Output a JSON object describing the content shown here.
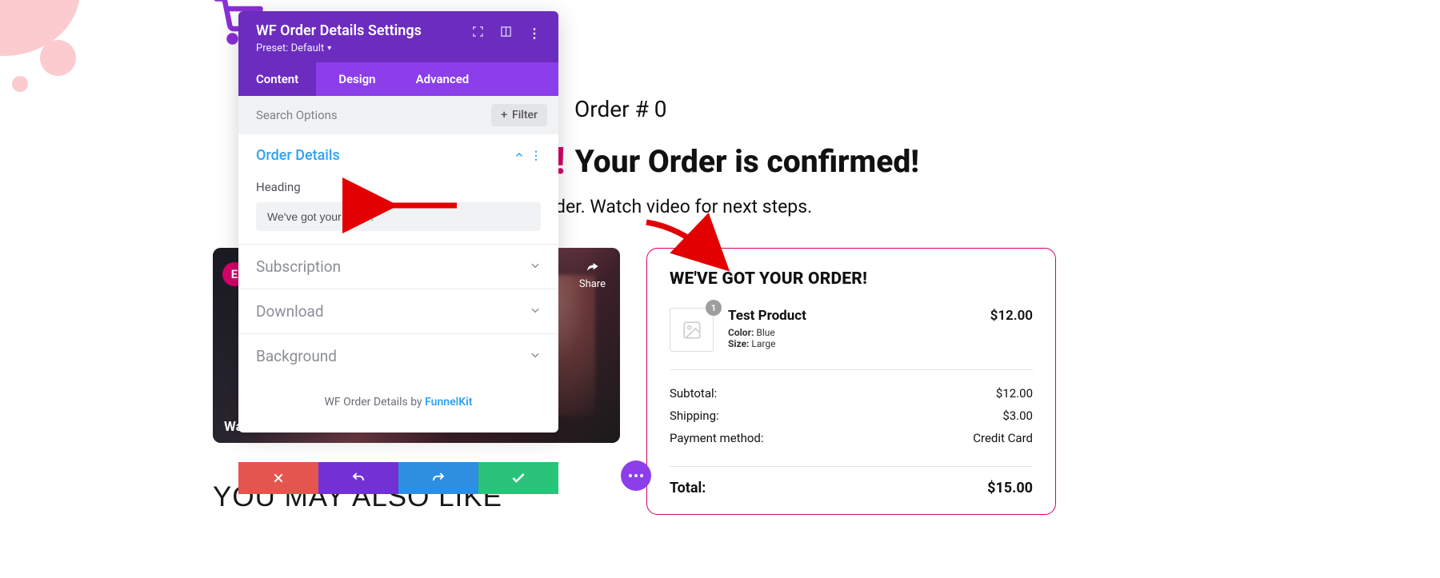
{
  "panel": {
    "title": "WF Order Details Settings",
    "preset_label": "Preset: Default",
    "tabs": {
      "content": "Content",
      "design": "Design",
      "advanced": "Advanced"
    },
    "search_placeholder": "Search Options",
    "filter_label": "Filter",
    "sections": {
      "order_details": {
        "title": "Order Details",
        "heading_label": "Heading",
        "heading_value": "We've got your order!"
      },
      "subscription": {
        "title": "Subscription"
      },
      "download": {
        "title": "Download"
      },
      "background": {
        "title": "Background"
      }
    },
    "attribution_prefix": "WF Order Details by ",
    "attribution_link": "FunnelKit"
  },
  "videothumb": {
    "badge": "E",
    "share_label": "Share",
    "caption_partial": "Wat"
  },
  "below_heading": "YOU MAY ALSO LIKE",
  "page": {
    "order_number": "Order # 0",
    "confirm_text": "Your Order is confirmed!",
    "subtext": "der. Watch video for next steps."
  },
  "card": {
    "title": "WE'VE GOT YOUR ORDER!",
    "product": {
      "qty": "1",
      "name": "Test Product",
      "color_label": "Color:",
      "color_value": "Blue",
      "size_label": "Size:",
      "size_value": "Large",
      "price": "$12.00"
    },
    "summary": {
      "subtotal_label": "Subtotal:",
      "subtotal_value": "$12.00",
      "shipping_label": "Shipping:",
      "shipping_value": "$3.00",
      "payment_label": "Payment method:",
      "payment_value": "Credit Card"
    },
    "total_label": "Total:",
    "total_value": "$15.00"
  }
}
